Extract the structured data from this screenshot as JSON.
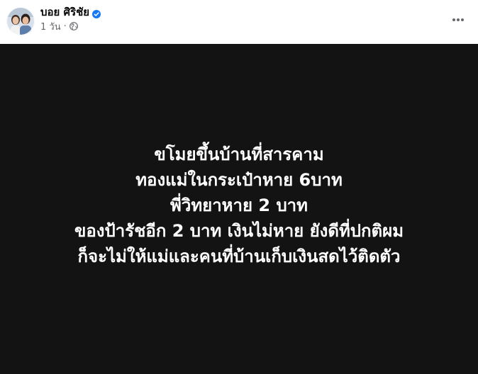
{
  "post": {
    "author": "บอย ศิริชัย",
    "verified_icon": "verified-badge-icon",
    "timestamp": "1 วัน",
    "separator": "·",
    "audience_icon": "globe-icon",
    "more_icon": "more-options-icon",
    "body_lines": [
      "ขโมยขึ้นบ้านที่สารคาม",
      "ทองแม่ในกระเป๋าหาย 6บาท",
      "พี่วิทยาหาย 2 บาท",
      "ของป้ารัชอีก 2 บาท เงินไม่หาย ยังดีที่ปกติผม",
      "ก็จะไม่ให้แม่และคนที่บ้านเก็บเงินสดไว้ติดตัว"
    ]
  },
  "colors": {
    "verified": "#1877f2",
    "meta_text": "#65676b",
    "body_background": "#131313",
    "body_text": "#ffffff"
  }
}
